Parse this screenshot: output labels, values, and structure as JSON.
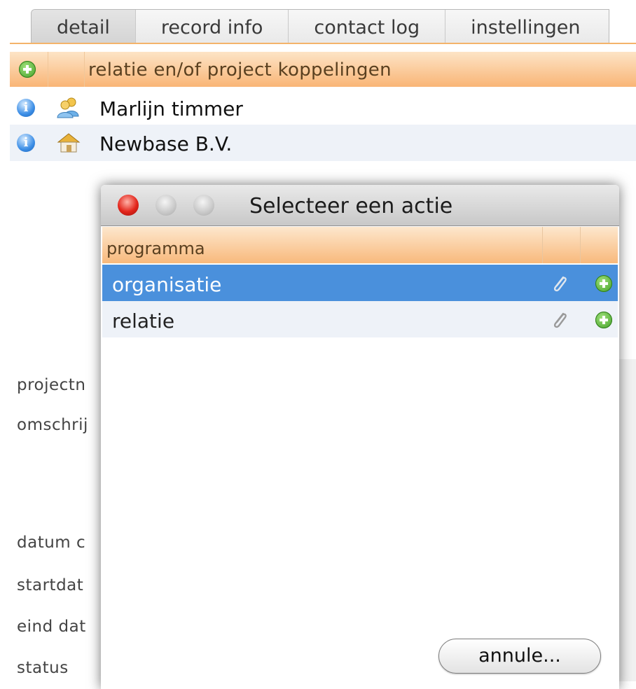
{
  "tabs": [
    "detail",
    "record info",
    "contact log",
    "instellingen"
  ],
  "links": {
    "header": "relatie en/of project koppelingen",
    "rows": [
      {
        "name": "Marlijn timmer",
        "type_icon": "people-icon"
      },
      {
        "name": "Newbase B.V.",
        "type_icon": "house-icon"
      }
    ]
  },
  "form_labels": [
    "projectn",
    "omschrij",
    "datum c",
    "startdat",
    "eind dat",
    "status"
  ],
  "dialog": {
    "title": "Selecteer een actie",
    "list_header": "programma",
    "items": [
      {
        "label": "organisatie",
        "selected": true
      },
      {
        "label": "relatie",
        "selected": false
      }
    ],
    "cancel_label": "annule..."
  },
  "colors": {
    "accent_orange": "#f9b576",
    "selection_blue": "#4a90dc",
    "close_red": "#e3251b",
    "add_green": "#3f9e25"
  }
}
